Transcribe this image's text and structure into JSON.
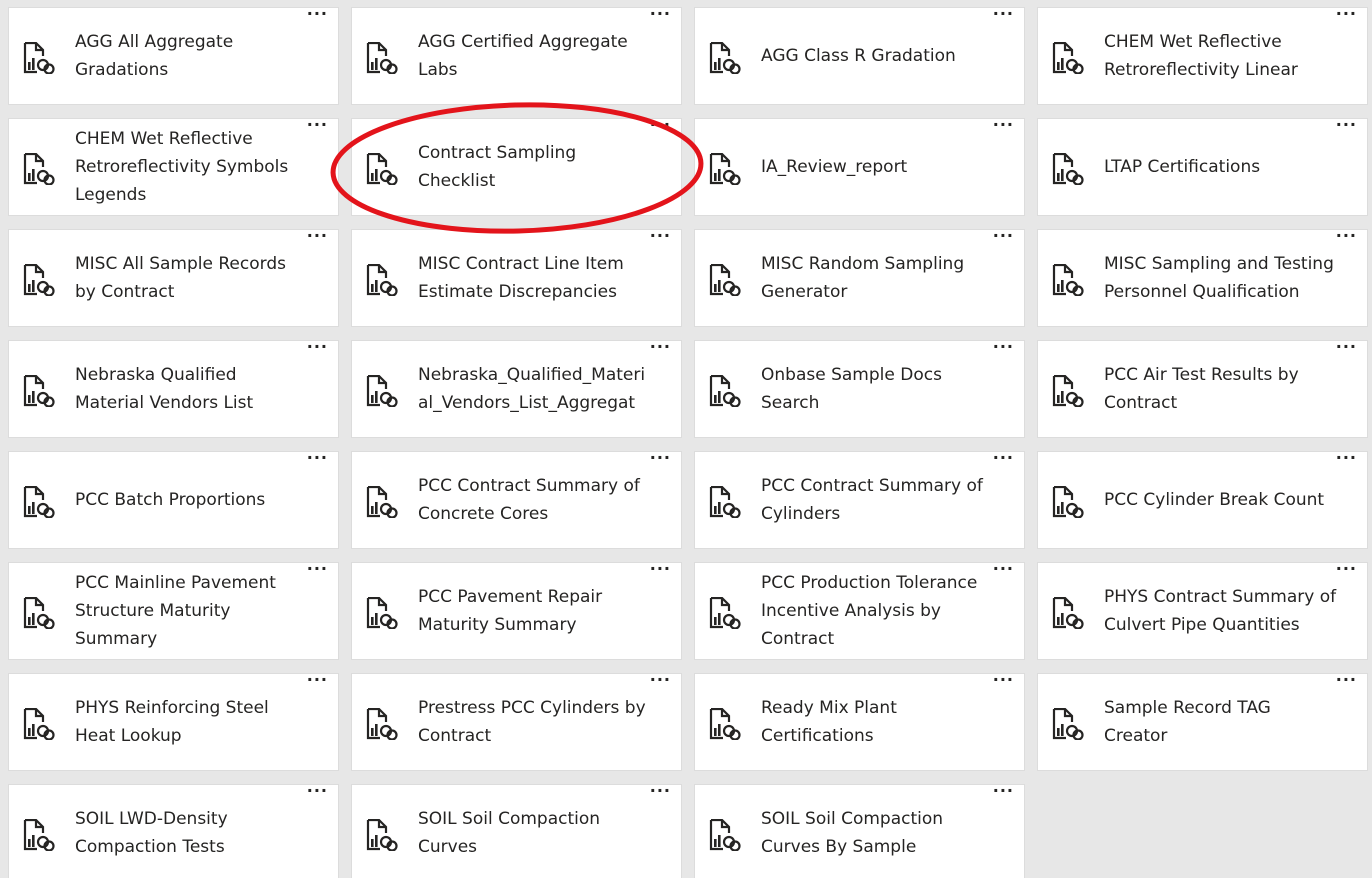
{
  "tile_more_label": "···",
  "report_icon": "report-document-icon",
  "colors": {
    "background": "#e7e7e7",
    "tile": "#ffffff",
    "text": "#252423",
    "annotation": "#e3141b"
  },
  "reports": [
    {
      "label": "AGG All Aggregate\nGradations"
    },
    {
      "label": "AGG Certified Aggregate\nLabs"
    },
    {
      "label": "AGG Class R Gradation"
    },
    {
      "label": "CHEM Wet Reflective\nRetroreflectivity Linear"
    },
    {
      "label": "CHEM Wet Reflective\nRetroreflectivity Symbols\nLegends"
    },
    {
      "label": "Contract Sampling\nChecklist"
    },
    {
      "label": "IA_Review_report"
    },
    {
      "label": "LTAP Certifications"
    },
    {
      "label": "MISC All Sample Records\nby Contract"
    },
    {
      "label": "MISC Contract Line Item\nEstimate Discrepancies"
    },
    {
      "label": "MISC Random Sampling\nGenerator"
    },
    {
      "label": "MISC Sampling and Testing\nPersonnel Qualification"
    },
    {
      "label": "Nebraska Qualified\nMaterial Vendors List"
    },
    {
      "label": "Nebraska_Qualified_Materi\nal_Vendors_List_Aggregat"
    },
    {
      "label": "Onbase Sample Docs\nSearch"
    },
    {
      "label": "PCC Air Test Results by\nContract"
    },
    {
      "label": "PCC Batch Proportions"
    },
    {
      "label": "PCC Contract Summary of\nConcrete Cores"
    },
    {
      "label": "PCC Contract Summary of\nCylinders"
    },
    {
      "label": "PCC Cylinder Break Count"
    },
    {
      "label": "PCC Mainline Pavement\nStructure Maturity\nSummary"
    },
    {
      "label": "PCC Pavement Repair\nMaturity Summary"
    },
    {
      "label": "PCC Production Tolerance\nIncentive Analysis by\nContract"
    },
    {
      "label": "PHYS Contract Summary of\nCulvert Pipe Quantities"
    },
    {
      "label": "PHYS Reinforcing Steel\nHeat Lookup"
    },
    {
      "label": "Prestress PCC Cylinders by\nContract"
    },
    {
      "label": "Ready Mix Plant\nCertifications"
    },
    {
      "label": "Sample Record TAG\nCreator"
    },
    {
      "label": "SOIL LWD-Density\nCompaction Tests"
    },
    {
      "label": "SOIL Soil Compaction\nCurves"
    },
    {
      "label": "SOIL Soil Compaction\nCurves By Sample"
    }
  ]
}
